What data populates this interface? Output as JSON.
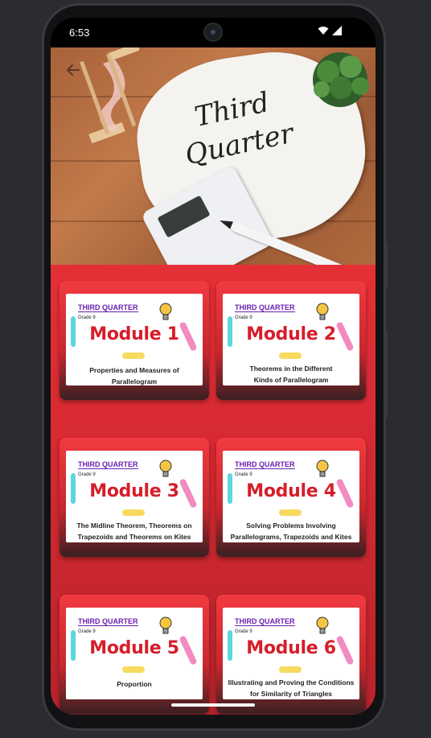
{
  "status_bar": {
    "time": "6:53"
  },
  "hero": {
    "title_line1": "Third",
    "title_line2": "Quarter"
  },
  "modules": [
    {
      "quarter": "THIRD QUARTER",
      "grade": "Grade 9",
      "title": "Module 1",
      "description_lines": [
        "Properties and Measures of Parallelogram"
      ]
    },
    {
      "quarter": "THIRD QUARTER",
      "grade": "Grade 9",
      "title": "Module 2",
      "description_lines": [
        "Theorems in the Different",
        "Kinds of Parallelogram"
      ]
    },
    {
      "quarter": "THIRD QUARTER",
      "grade": "Grade 9",
      "title": "Module 3",
      "description_lines": [
        "The Midline Theorem, Theorems on",
        "Trapezoids and Theorems on Kites"
      ]
    },
    {
      "quarter": "THIRD QUARTER",
      "grade": "Grade 9",
      "title": "Module 4",
      "description_lines": [
        "Solving Problems Involving",
        "Parallelograms, Trapezoids and Kites"
      ]
    },
    {
      "quarter": "THIRD QUARTER",
      "grade": "Grade 9",
      "title": "Module 5",
      "description_lines": [
        "Proportion"
      ]
    },
    {
      "quarter": "THIRD QUARTER",
      "grade": "Grade 9",
      "title": "Module 6",
      "description_lines": [
        "Illustrating and Proving the Conditions",
        "for Similarity of Triangles"
      ]
    }
  ],
  "icons": {
    "back": "arrow-back-icon",
    "wifi": "wifi-icon",
    "signal": "cell-signal-icon"
  },
  "colors": {
    "accent_red": "#e52f36",
    "module_title_red": "#d61e2a",
    "quarter_purple": "#6b1fb0"
  }
}
